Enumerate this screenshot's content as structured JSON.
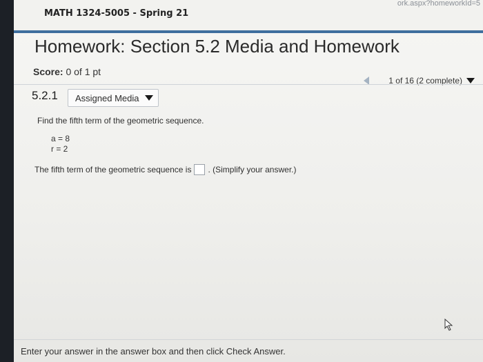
{
  "browser": {
    "url_fragment": "ork.aspx?homeworkId=5"
  },
  "course": {
    "title": "MATH 1324-5005 - Spring 21"
  },
  "homework": {
    "title": "Homework: Section 5.2 Media and Homework"
  },
  "score": {
    "label": "Score:",
    "value": "0 of 1 pt"
  },
  "navigation": {
    "progress": "1 of 16 (2 complete)"
  },
  "question": {
    "number": "5.2.1",
    "media_button_label": "Assigned Media",
    "prompt": "Find the fifth term of the geometric sequence.",
    "given": [
      "a = 8",
      "r = 2"
    ],
    "answer_prefix": "The fifth term of the geometric sequence is",
    "answer_suffix": ". (Simplify your answer.)",
    "answer_value": ""
  },
  "footer": {
    "hint": "Enter your answer in the answer box and then click Check Answer."
  },
  "colors": {
    "accent": "#3f6f9e",
    "background": "#f3f3f0"
  }
}
